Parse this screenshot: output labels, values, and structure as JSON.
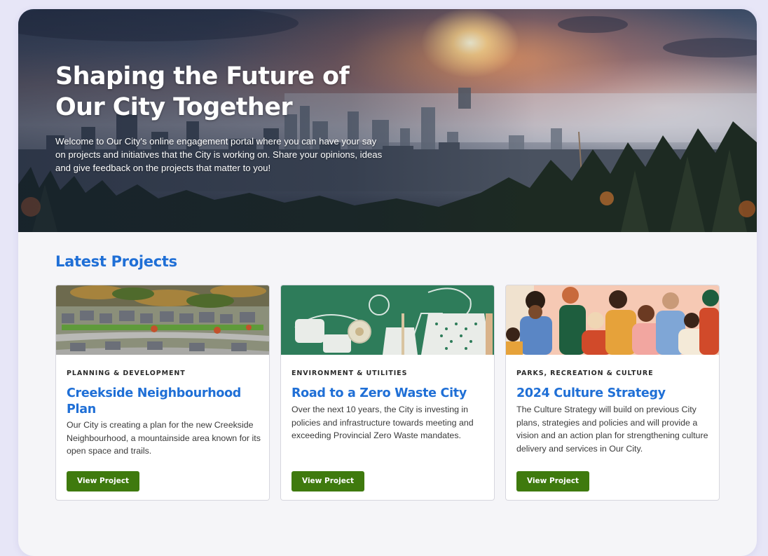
{
  "hero": {
    "title": "Shaping the Future of Our City Together",
    "text": "Welcome to Our City's online engagement portal where you can have your say on projects and initiatives that the City is working on. Share your opinions, ideas and give feedback on the projects that matter to you!"
  },
  "section": {
    "title": "Latest Projects"
  },
  "cards": [
    {
      "category": "PLANNING & DEVELOPMENT",
      "title": "Creekside Neighbourhood Plan",
      "description": "Our City is creating a plan for the new Creekside Neighbourhood, a mountainside area known for its open space and trails.",
      "button": "View Project"
    },
    {
      "category": "ENVIRONMENT & UTILITIES",
      "title": "Road to a Zero Waste City",
      "description": "Over the next 10 years, the City is investing in policies and infrastructure towards meeting and exceeding Provincial Zero Waste mandates.",
      "button": "View Project"
    },
    {
      "category": "PARKS, RECREATION & CULTURE",
      "title": "2024 Culture Strategy",
      "description": "The Culture Strategy will build on previous City plans, strategies and policies and will provide a vision and an action plan for strengthening culture delivery and services in Our City.",
      "button": "View Project"
    }
  ],
  "colors": {
    "accent_blue": "#1f6fd6",
    "button_green": "#3f7a0e",
    "page_background": "#e7e6f7"
  }
}
